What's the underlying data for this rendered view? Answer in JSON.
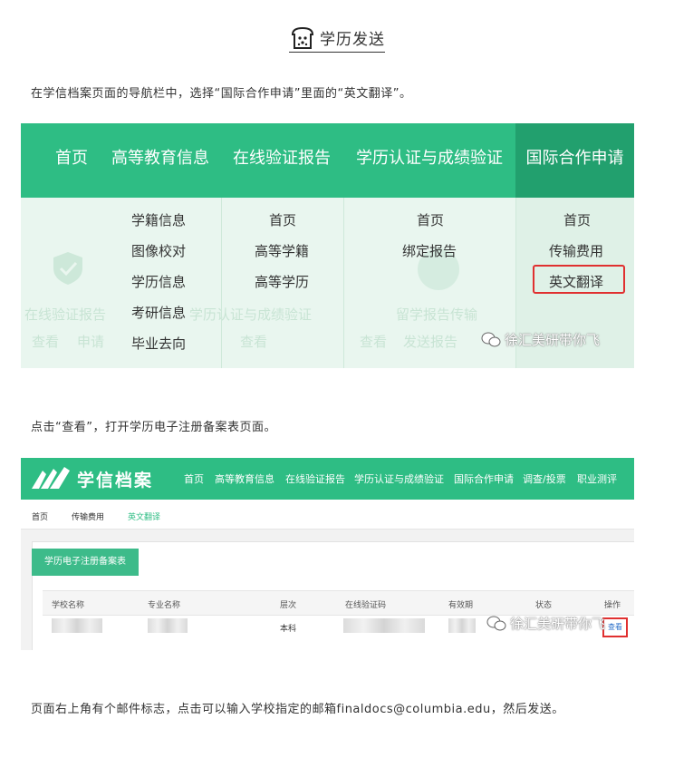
{
  "heading": {
    "title": "学历发送"
  },
  "paragraphs": {
    "p1": "在学信档案页面的导航栏中，选择“国际合作申请”里面的“英文翻译”。",
    "p2": "点击“查看”，打开学历电子注册备案表页面。",
    "p3": "页面右上角有个邮件标志，点击可以输入学校指定的邮箱finaldocs@columbia.edu，然后发送。"
  },
  "shot1": {
    "nav": [
      "首页",
      "高等教育信息",
      "在线验证报告",
      "学历认证与成绩验证",
      "国际合作申请"
    ],
    "col1": [
      "学籍信息",
      "图像校对",
      "学历信息",
      "考研信息",
      "毕业去向"
    ],
    "col2": [
      "首页",
      "高等学籍",
      "高等学历"
    ],
    "col3": [
      "首页",
      "绑定报告"
    ],
    "col4": [
      "首页",
      "传输费用",
      "英文翻译"
    ],
    "faded": [
      "在线验证报告",
      "学历认证与成绩验证",
      "留学报告传输",
      "查看",
      "申请",
      "查看",
      "查看",
      "发送报告"
    ],
    "watermark": "徐汇美研带你飞"
  },
  "shot2": {
    "brand": "学信档案",
    "nav": [
      "首页",
      "高等教育信息",
      "在线验证报告",
      "学历认证与成绩验证",
      "国际合作申请",
      "调查/投票",
      "职业测评"
    ],
    "crumbs": [
      "首页",
      "传输费用",
      "英文翻译"
    ],
    "panel_tab": "学历电子注册备案表",
    "columns": [
      "学校名称",
      "专业名称",
      "层次",
      "在线验证码",
      "有效期",
      "状态",
      "操作"
    ],
    "row": {
      "level": "本科",
      "action": "查看"
    },
    "watermark": "徐汇美研带你飞"
  },
  "colors": {
    "brand_green": "#2ebd84",
    "active_green": "#22a06e",
    "highlight_red": "#e03030"
  }
}
